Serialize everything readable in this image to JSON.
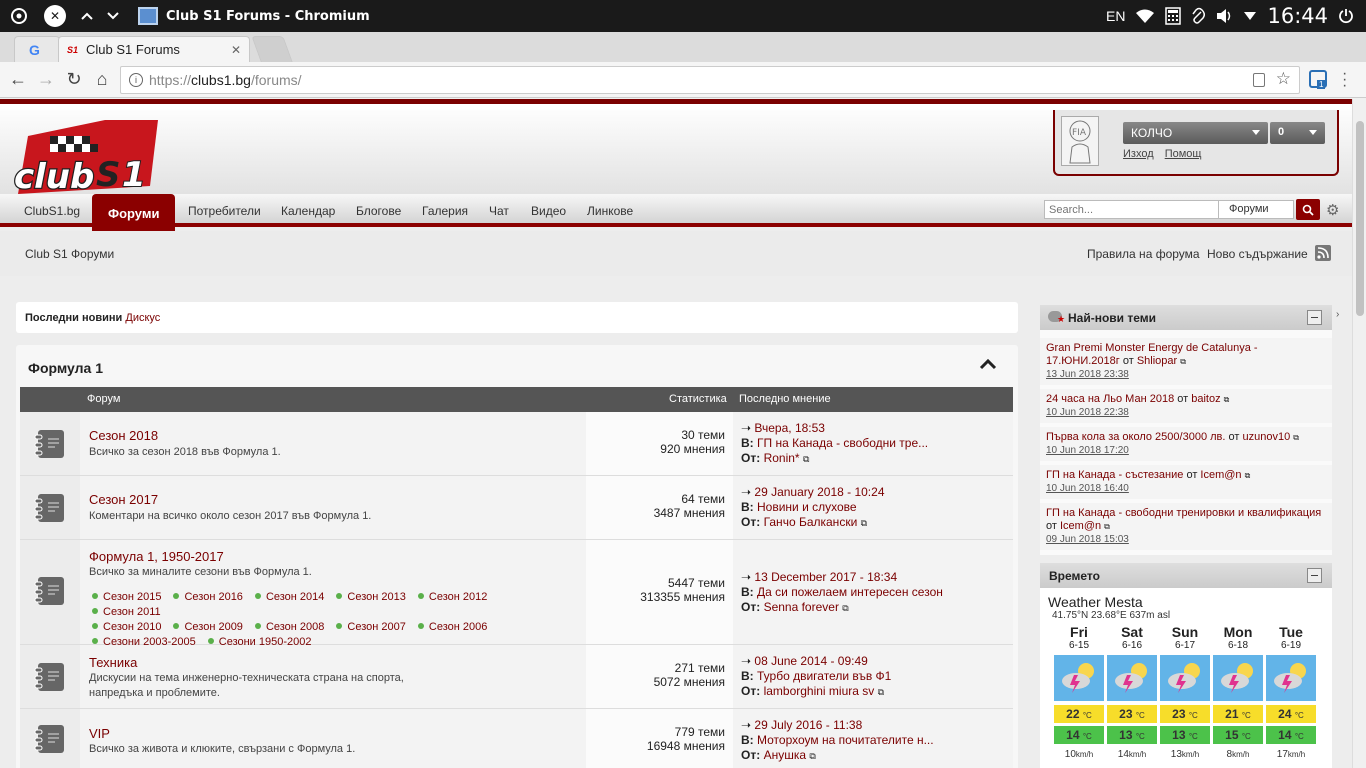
{
  "os": {
    "window_title": "Club S1 Forums - Chromium",
    "lang": "EN",
    "clock": "16:44"
  },
  "browser": {
    "tabs": [
      {
        "label": "Club S1 Forums"
      }
    ],
    "url_scheme": "https://",
    "url_host": "clubs1.bg",
    "url_path": "/forums/",
    "ext_badge": "1"
  },
  "header": {
    "username": "КОЛЧО",
    "notifications": "0",
    "logout": "Изход",
    "help": "Помощ"
  },
  "nav": {
    "items": [
      "ClubS1.bg",
      "Форуми",
      "Потребители",
      "Календар",
      "Блогове",
      "Галерия",
      "Чат",
      "Видео",
      "Линкове"
    ],
    "search_placeholder": "Search...",
    "search_scope": "Форуми"
  },
  "breadcrumb": "Club S1 Форуми",
  "sublinks": {
    "rules": "Правила на форума",
    "new_content": "Ново съдържание"
  },
  "news": {
    "label": "Последни новини",
    "link": "Дискус"
  },
  "forum_section": {
    "title": "Формула 1",
    "col_forum": "Форум",
    "col_stats": "Статистика",
    "col_last": "Последно мнение",
    "rows": [
      {
        "title": "Сезон 2018",
        "desc": "Всичко за сезон 2018 във Формула 1.",
        "topics": "30 теми",
        "posts": "920 мнения",
        "last_date": "Вчера, 18:53",
        "last_in_label": "В:",
        "last_in": "ГП на Канада - свободни тре...",
        "last_by_label": "От:",
        "last_by": "Ronin*"
      },
      {
        "title": "Сезон 2017",
        "desc": "Коментари на всичко около сезон 2017 във Формула 1.",
        "topics": "64 теми",
        "posts": "3487 мнения",
        "last_date": "29 January 2018 - 10:24",
        "last_in_label": "В:",
        "last_in": "Новини и слухове",
        "last_by_label": "От:",
        "last_by": "Ганчо Балкански"
      },
      {
        "title": "Формула 1, 1950-2017",
        "desc": "Всичко за миналите сезони във Формула 1.",
        "topics": "5447 теми",
        "posts": "313355 мнения",
        "last_date": "13 December 2017 - 18:34",
        "last_in_label": "В:",
        "last_in": "Да си пожелаем интересен сезон",
        "last_by_label": "От:",
        "last_by": "Senna forever",
        "subforums": [
          "Сезон 2015",
          "Сезон 2016",
          "Сезон 2014",
          "Сезон 2013",
          "Сезон 2012",
          "Сезон 2011",
          "Сезон 2010",
          "Сезон 2009",
          "Сезон 2008",
          "Сезон 2007",
          "Сезон 2006",
          "Сезони 2003-2005",
          "Сезони 1950-2002"
        ]
      },
      {
        "title": "Техника",
        "desc": "Дискусии на тема инженерно-техническата страна на спорта, напредъка и проблемите.",
        "topics": "271 теми",
        "posts": "5072 мнения",
        "last_date": "08 June 2014 - 09:49",
        "last_in_label": "В:",
        "last_in": "Турбо двигатели във Ф1",
        "last_by_label": "От:",
        "last_by": "lamborghini miura sv"
      },
      {
        "title": "VIP",
        "desc": "Всичко за живота и клюките, свързани с Формула 1.",
        "topics": "779 теми",
        "posts": "16948 мнения",
        "last_date": "29 July 2016 - 11:38",
        "last_in_label": "В:",
        "last_in": "Моторхоум на почитателите н...",
        "last_by_label": "От:",
        "last_by": "Анушка"
      }
    ]
  },
  "sidebar": {
    "new_topics_title": "Най-нови теми",
    "by_word": "от",
    "new_topics": [
      {
        "title": "Gran Premi Monster Energy de Catalunya - 17.ЮНИ.2018г",
        "author": "Shliopar",
        "date": "13 Jun 2018 23:38"
      },
      {
        "title": "24 часа на Льо Ман 2018",
        "author": "baitoz",
        "date": "10 Jun 2018 22:38"
      },
      {
        "title": "Първа кола за около 2500/3000 лв.",
        "author": "uzunov10",
        "date": "10 Jun 2018 17:20"
      },
      {
        "title": "ГП на Канада - състезание",
        "author": "Icem@n",
        "date": "10 Jun 2018 16:40"
      },
      {
        "title": "ГП на Канада - свободни тренировки и квалификация",
        "author": "Icem@n",
        "date": "09 Jun 2018 15:03"
      }
    ],
    "weather_title": "Времето",
    "weather_place": "Weather Mesta",
    "weather_coords": "41.75°N 23.68°E 637m asl",
    "temp_unit": "°C",
    "days": [
      {
        "name": "Fri",
        "date": "6-15",
        "hi": "22",
        "lo": "14",
        "wind": "10",
        "wind_unit": "km/h"
      },
      {
        "name": "Sat",
        "date": "6-16",
        "hi": "23",
        "lo": "13",
        "wind": "14",
        "wind_unit": "km/h"
      },
      {
        "name": "Sun",
        "date": "6-17",
        "hi": "23",
        "lo": "13",
        "wind": "13",
        "wind_unit": "km/h"
      },
      {
        "name": "Mon",
        "date": "6-18",
        "hi": "21",
        "lo": "15",
        "wind": "8",
        "wind_unit": "km/h"
      },
      {
        "name": "Tue",
        "date": "6-19",
        "hi": "24",
        "lo": "14",
        "wind": "17",
        "wind_unit": "km/h"
      }
    ]
  }
}
